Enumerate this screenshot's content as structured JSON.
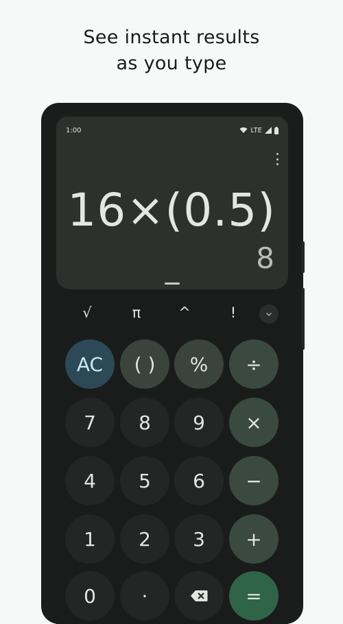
{
  "headline": {
    "line1": "See instant results",
    "line2": "as you type"
  },
  "status_bar": {
    "time": "1:00",
    "network": "LTE",
    "icons": [
      "wifi-icon",
      "signal-icon",
      "battery-icon"
    ]
  },
  "display": {
    "expression": "16×(0.5)",
    "result": "8"
  },
  "scientific_row": [
    "√",
    "π",
    "^",
    "!"
  ],
  "keypad": {
    "row1": [
      "AC",
      "( )",
      "%",
      "÷"
    ],
    "row2": [
      "7",
      "8",
      "9",
      "×"
    ],
    "row3": [
      "4",
      "5",
      "6",
      "−"
    ],
    "row4": [
      "1",
      "2",
      "3",
      "+"
    ],
    "row5": [
      "0",
      "·",
      "backspace-icon",
      "="
    ]
  },
  "colors": {
    "background": "#f7f8f8",
    "display": "#2d312e",
    "ac_key": "#2c4958",
    "operator_key": "#3b4a40",
    "equals_key": "#2f6448"
  }
}
